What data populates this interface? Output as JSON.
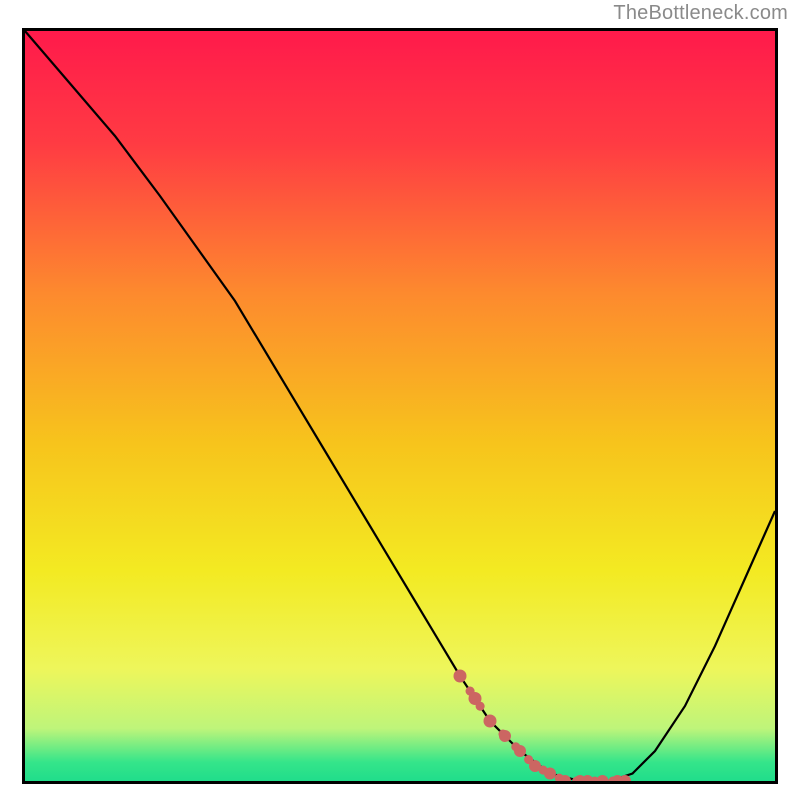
{
  "attribution": "TheBottleneck.com",
  "chart_data": {
    "type": "line",
    "title": "",
    "xlabel": "",
    "ylabel": "",
    "xlim": [
      0,
      100
    ],
    "ylim": [
      0,
      100
    ],
    "grid": false,
    "legend": false,
    "series": [
      {
        "name": "curve",
        "x": [
          0,
          6,
          12,
          18,
          23,
          28,
          34,
          40,
          46,
          52,
          58,
          62,
          66,
          70,
          74,
          78,
          81,
          84,
          88,
          92,
          96,
          100
        ],
        "y": [
          100,
          93,
          86,
          78,
          71,
          64,
          54,
          44,
          34,
          24,
          14,
          8,
          4,
          1,
          0,
          0,
          1,
          4,
          10,
          18,
          27,
          36
        ]
      },
      {
        "name": "highlight",
        "x": [
          58,
          60,
          62,
          64,
          66,
          68,
          70,
          72,
          74,
          75,
          77,
          79,
          80
        ],
        "y": [
          14,
          11,
          8,
          6,
          4,
          2,
          1,
          0,
          0,
          0,
          0,
          0,
          0
        ]
      }
    ],
    "background_gradient": {
      "stops": [
        {
          "offset": 0.0,
          "color": "#ff1a4b"
        },
        {
          "offset": 0.15,
          "color": "#ff3b43"
        },
        {
          "offset": 0.35,
          "color": "#fd8a2e"
        },
        {
          "offset": 0.55,
          "color": "#f7c41c"
        },
        {
          "offset": 0.72,
          "color": "#f3ea22"
        },
        {
          "offset": 0.85,
          "color": "#eef65b"
        },
        {
          "offset": 0.93,
          "color": "#bef57a"
        },
        {
          "offset": 0.975,
          "color": "#35e58a"
        },
        {
          "offset": 1.0,
          "color": "#20dd8b"
        }
      ]
    },
    "colors": {
      "curve": "#000000",
      "highlight": "#cc6662"
    }
  }
}
